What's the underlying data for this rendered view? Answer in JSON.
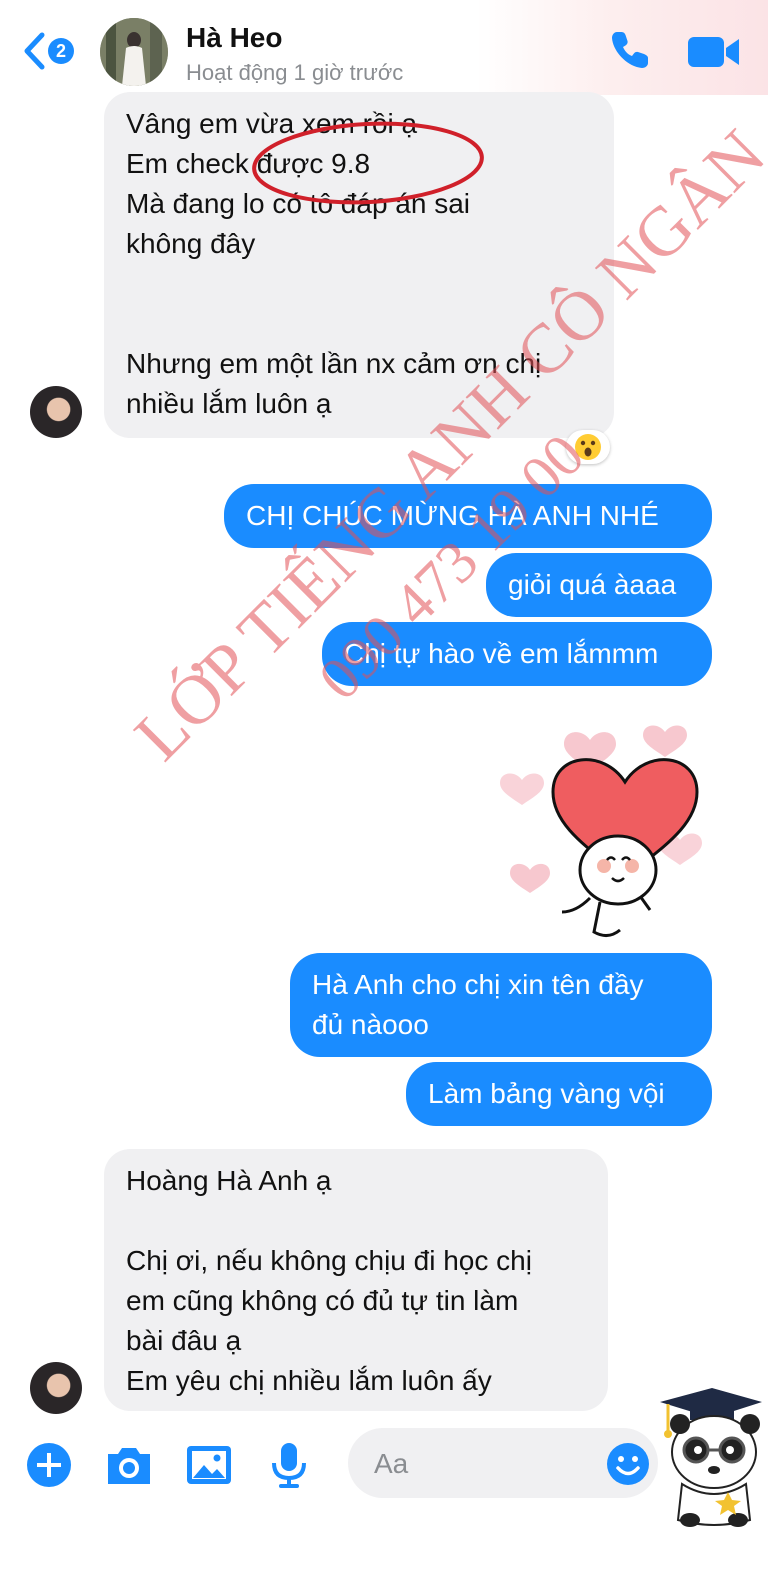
{
  "header": {
    "back_badge_count": "2",
    "contact_name": "Hà Heo",
    "status": "Hoạt động 1 giờ trước"
  },
  "messages": [
    {
      "from": "contact",
      "text": "Vâng em vừa xem rồi ạ\nEm check được 9.8\nMà đang lo có tô đáp án sai\nkhông đây\n\n\nNhưng em một lần nx cảm ơn chị\nnhiều lắm luôn ạ",
      "reaction": "astonished-face"
    },
    {
      "from": "me",
      "text": "CHỊ CHÚC MỪNG HÀ ANH NHÉ"
    },
    {
      "from": "me",
      "text": "giỏi quá àaaa"
    },
    {
      "from": "me",
      "text": "Chị tự hào về em lắmmm"
    },
    {
      "from": "me",
      "sticker": "heart-character-sticker"
    },
    {
      "from": "me",
      "text": "Hà Anh cho chị xin tên đầy\nđủ nàooo"
    },
    {
      "from": "me",
      "text": "Làm bảng vàng vội"
    },
    {
      "from": "contact",
      "text": "Hoàng Hà Anh ạ\n\nChị ơi, nếu không chịu đi học chị\nem cũng không có đủ tự tin làm\nbài đâu ạ\nEm yêu chị nhiều lắm luôn ấy"
    }
  ],
  "watermark": {
    "line1": "LỚP TIẾNG ANH CÔ NGÂN",
    "line2": "090 473 19 00"
  },
  "composer": {
    "placeholder": "Aa"
  },
  "colors": {
    "accent": "#1a8cff",
    "incoming_bubble": "#f0f0f2",
    "annotation": "#d0202a",
    "watermark": "#e15055"
  },
  "icons": {
    "back": "chevron-left-icon",
    "call": "phone-icon",
    "video": "video-camera-icon",
    "toolbar": [
      "plus-icon",
      "camera-icon",
      "image-icon",
      "microphone-icon"
    ],
    "emoji": "smiley-icon"
  }
}
